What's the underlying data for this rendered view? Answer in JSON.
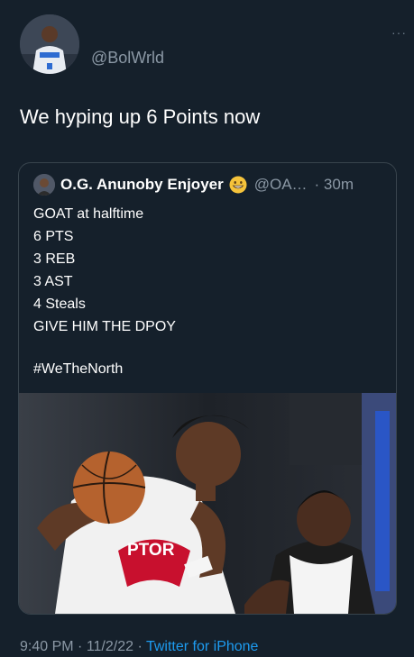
{
  "tweet": {
    "handle": "@BolWrld",
    "text": "We hyping up 6 Points now",
    "more_icon": "more-dots-icon",
    "footer": {
      "time": "9:40 PM",
      "separator": " · ",
      "date": "11/2/22",
      "separator2": " · ",
      "source": "Twitter for iPhone"
    }
  },
  "quote": {
    "name": "O.G. Anunoby Enjoyer",
    "emoji_icon": "grinning-face-emoji",
    "handle": "@OA…",
    "time": "· 30m",
    "lines": [
      "GOAT at halftime",
      "6 PTS",
      "3 REB",
      "3 AST",
      "4 Steals",
      "GIVE HIM THE DPOY"
    ],
    "hashtag": "#WeTheNorth",
    "photo_jersey_text": "PTOR"
  },
  "colors": {
    "background": "#15202b",
    "text": "#ffffff",
    "secondary": "#8b98a5",
    "link": "#1d9bf0",
    "border": "#38444d"
  }
}
